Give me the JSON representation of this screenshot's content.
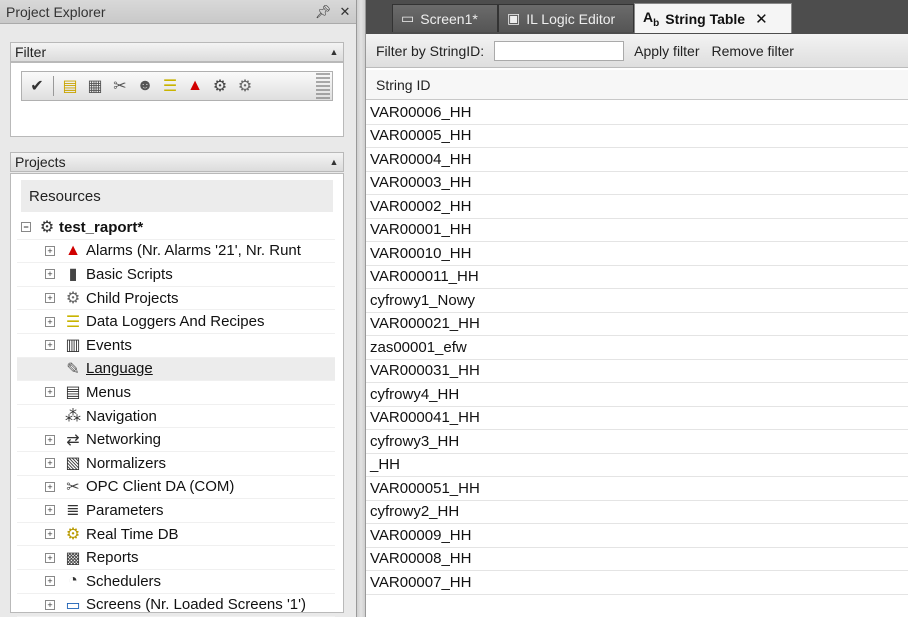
{
  "left_panel": {
    "title": "Project Explorer",
    "pin_icon": "pin-icon",
    "close_icon": "close-icon",
    "filter_section": {
      "title": "Filter",
      "toolbar_icons": [
        "check-icon",
        "basic-scripts-filter-icon",
        "users-filter-icon",
        "opc-filter-icon",
        "user-groups-icon",
        "data-loggers-icon",
        "alarm-icon",
        "gear-icon",
        "child-projects-icon"
      ]
    },
    "projects_section": {
      "title": "Projects",
      "resources_label": "Resources",
      "tree": [
        {
          "label": "test_raport*",
          "icon": "project-gear-icon",
          "expander": "⊟",
          "root": true
        },
        {
          "label": "Alarms (Nr. Alarms '21', Nr. Runt",
          "icon": "alarm-bell-icon",
          "expander": "⊞"
        },
        {
          "label": "Basic Scripts",
          "icon": "script-icon",
          "expander": "⊞"
        },
        {
          "label": "Child Projects",
          "icon": "child-projects-icon",
          "expander": "⊞"
        },
        {
          "label": "Data Loggers And Recipes",
          "icon": "database-icon",
          "expander": "⊞"
        },
        {
          "label": "Events",
          "icon": "events-icon",
          "expander": "⊞"
        },
        {
          "label": "Language",
          "icon": "language-icon",
          "expander": "",
          "selected": true
        },
        {
          "label": "Menus",
          "icon": "menus-icon",
          "expander": "⊞"
        },
        {
          "label": "Navigation",
          "icon": "navigation-icon",
          "expander": ""
        },
        {
          "label": "Networking",
          "icon": "networking-icon",
          "expander": "⊞"
        },
        {
          "label": "Normalizers",
          "icon": "normalizers-icon",
          "expander": "⊞"
        },
        {
          "label": "OPC Client DA (COM)",
          "icon": "opc-client-icon",
          "expander": "⊞"
        },
        {
          "label": "Parameters",
          "icon": "parameters-icon",
          "expander": "⊞"
        },
        {
          "label": "Real Time DB",
          "icon": "realtime-db-icon",
          "expander": "⊞"
        },
        {
          "label": "Reports",
          "icon": "reports-icon",
          "expander": "⊞"
        },
        {
          "label": "Schedulers",
          "icon": "scheduler-clock-icon",
          "expander": "⊞"
        },
        {
          "label": "Screens (Nr. Loaded Screens '1')",
          "icon": "screens-monitor-icon",
          "expander": "⊞"
        }
      ]
    }
  },
  "tabs": [
    {
      "label": "Screen1*",
      "icon": "screen-icon",
      "active": false
    },
    {
      "label": "IL Logic Editor",
      "icon": "il-logic-icon",
      "active": false
    },
    {
      "label": "String Table",
      "icon": "string-table-icon",
      "active": true
    }
  ],
  "filterbar": {
    "label": "Filter by StringID:",
    "input_value": "",
    "apply_label": "Apply filter",
    "remove_label": "Remove filter"
  },
  "table": {
    "column_header": "String ID",
    "rows": [
      "VAR00006_HH",
      "VAR00005_HH",
      "VAR00004_HH",
      "VAR00003_HH",
      "VAR00002_HH",
      "VAR00001_HH",
      "VAR00010_HH",
      "VAR000011_HH",
      "cyfrowy1_Nowy",
      "VAR000021_HH",
      "zas00001_efw",
      "VAR000031_HH",
      "cyfrowy4_HH",
      "VAR000041_HH",
      "cyfrowy3_HH",
      "_HH",
      "VAR000051_HH",
      "cyfrowy2_HH",
      "VAR00009_HH",
      "VAR00008_HH",
      "VAR00007_HH"
    ]
  }
}
